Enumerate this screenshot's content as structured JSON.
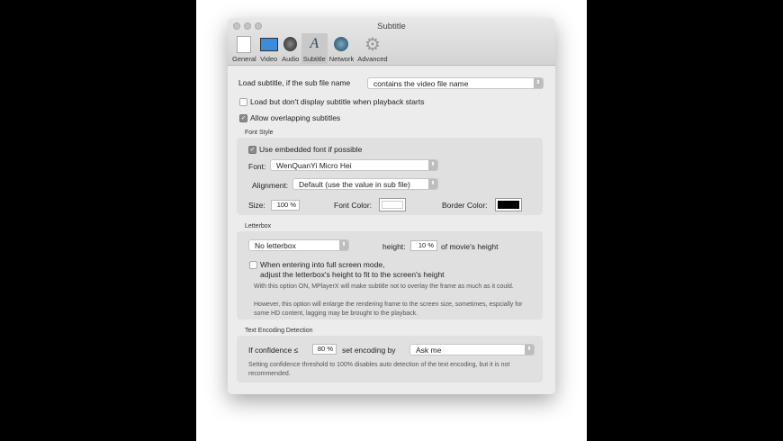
{
  "window": {
    "title": "Subtitle"
  },
  "toolbar": {
    "tabs": [
      {
        "label": "General",
        "icon": "general-icon"
      },
      {
        "label": "Video",
        "icon": "monitor-icon"
      },
      {
        "label": "Audio",
        "icon": "speaker-icon"
      },
      {
        "label": "Subtitle",
        "icon": "font-a-icon",
        "selected": true
      },
      {
        "label": "Network",
        "icon": "globe-icon"
      },
      {
        "label": "Advanced",
        "icon": "gear-icon"
      }
    ]
  },
  "load": {
    "label": "Load subtitle, if the sub file name",
    "value": "contains the video file name"
  },
  "load_no_display": {
    "label": "Load but don't display subtitle when playback starts",
    "checked": false
  },
  "allow_overlap": {
    "label": "Allow overlapping subtitles",
    "checked": true
  },
  "font_style": {
    "section": "Font Style",
    "embedded": {
      "label": "Use embedded font if possible",
      "checked": true
    },
    "font_label": "Font:",
    "font_value": "WenQuanYi Micro Hei",
    "alignment_label": "Alignment:",
    "alignment_value": "Default (use the value in sub file)",
    "size_label": "Size:",
    "size_value": "100 %",
    "font_color_label": "Font Color:",
    "border_color_label": "Border Color:",
    "font_color": "#ffffff",
    "border_color": "#000000"
  },
  "letterbox": {
    "section": "Letterbox",
    "mode": "No letterbox",
    "height_label": "height:",
    "height_value": "10 %",
    "height_suffix": "of movie's height",
    "fullscreen_line1": "When entering into full screen mode,",
    "fullscreen_line2": "adjust the letterbox's height to fit to the screen's height",
    "fullscreen_checked": false,
    "note1": "With this option ON, MPlayerX will make subtitle not to overlay the frame as much as it could.",
    "note2": "However, this option will enlarge the rendering frame to the screen size, sometimes, espcially for some HD content, lagging may be brought to the playback."
  },
  "encoding": {
    "section": "Text Encoding Detection",
    "confidence_label": "If confidence ≤",
    "confidence_value": "80 %",
    "set_label": "set encoding by",
    "set_value": "Ask me",
    "note": "Setting confidence threshold to 100% disables auto detection of the text encoding, but it is not recommended."
  }
}
